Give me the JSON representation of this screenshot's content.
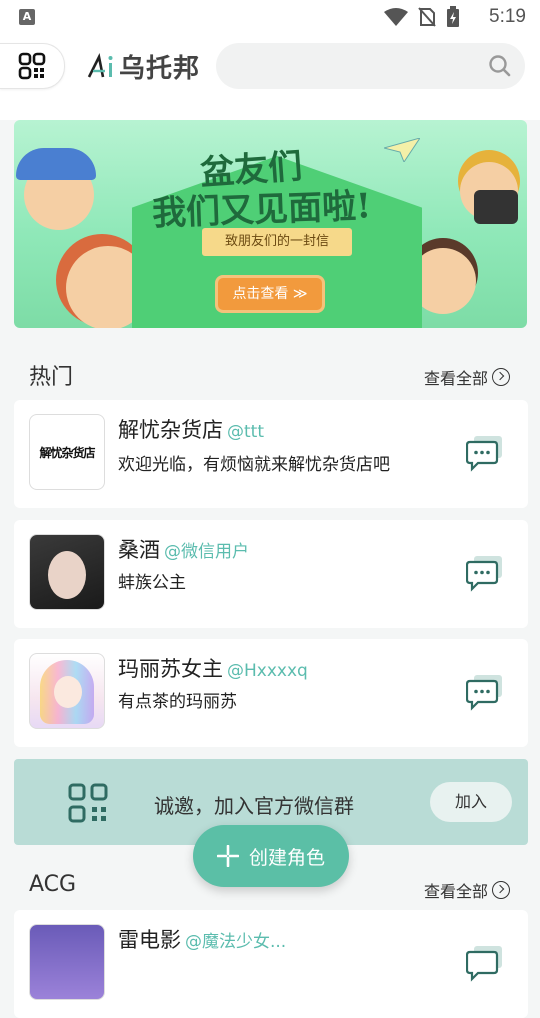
{
  "status": {
    "time": "5:19",
    "a_badge": "A"
  },
  "app": {
    "name": "乌托邦"
  },
  "search": {
    "placeholder": ""
  },
  "banner": {
    "title_line1": "盆友们",
    "title_line2": "我们又见面啦!",
    "subtitle": "致朋友们的一封信",
    "cta": "点击查看 ≫"
  },
  "hot": {
    "title": "热门",
    "more": "查看全部",
    "items": [
      {
        "name": "解忧杂货店",
        "handle": "@ttt",
        "desc": "欢迎光临，有烦恼就来解忧杂货店吧",
        "avatar_text": "解忧杂货店"
      },
      {
        "name": "桑酒",
        "handle": "@微信用户",
        "desc": "蚌族公主"
      },
      {
        "name": "玛丽苏女主",
        "handle": "@Hxxxxq",
        "desc": "有点茶的玛丽苏"
      }
    ]
  },
  "wechat": {
    "text": "诚邀，加入官方微信群",
    "join": "加入"
  },
  "fab": {
    "label": "创建角色"
  },
  "acg": {
    "title": "ACG",
    "more": "查看全部",
    "items": [
      {
        "name": "雷电影",
        "handle": "@魔法少女..."
      }
    ]
  },
  "colors": {
    "accent": "#5bbfa6",
    "handle": "#5bbcae",
    "chat_icon": "#2f6b62"
  }
}
